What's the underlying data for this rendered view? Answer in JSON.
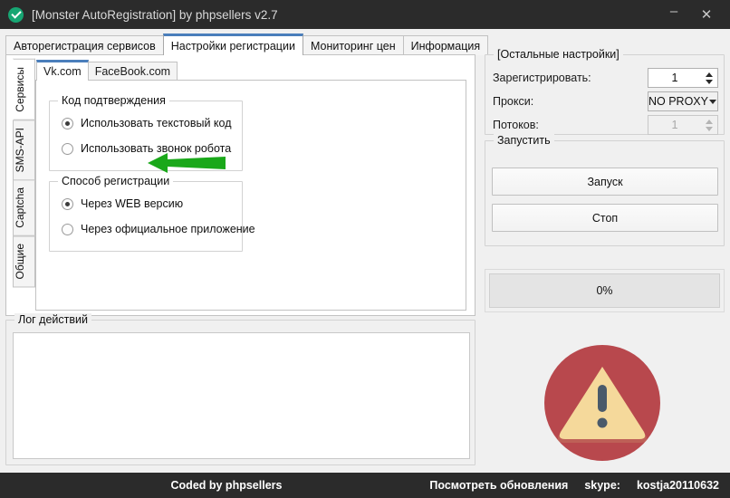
{
  "window": {
    "title": "[Monster AutoRegistration] by phpsellers v2.7",
    "icon": "green-check-circle-icon",
    "minimize_label": "–",
    "close_label": "✕",
    "accent_color": "#4a7ebb",
    "titlebar_color": "#2b2b2b"
  },
  "tabs": [
    {
      "label": "Авторегистрация сервисов",
      "selected": false
    },
    {
      "label": "Настройки регистрации",
      "selected": true
    },
    {
      "label": "Мониторинг цен",
      "selected": false
    },
    {
      "label": "Информация",
      "selected": false
    }
  ],
  "vertical_tabs": [
    {
      "label": "Сервисы",
      "selected": true
    },
    {
      "label": "SMS-API",
      "selected": false
    },
    {
      "label": "Captcha",
      "selected": false
    },
    {
      "label": "Общие",
      "selected": false
    }
  ],
  "service_tabs": [
    {
      "label": "Vk.com",
      "selected": true
    },
    {
      "label": "FaceBook.com",
      "selected": false
    }
  ],
  "confirm_group": {
    "title": "Код подтверждения",
    "options": [
      {
        "label": "Использовать текстовый код",
        "checked": true
      },
      {
        "label": "Использовать звонок робота",
        "checked": false
      }
    ]
  },
  "method_group": {
    "title": "Способ регистрации",
    "options": [
      {
        "label": "Через WEB версию",
        "checked": true
      },
      {
        "label": "Через официальное приложение",
        "checked": false
      }
    ]
  },
  "annotation": {
    "type": "left-arrow",
    "color": "#1aa81a",
    "points_at": "Способ регистрации"
  },
  "log_group": {
    "title": "Лог действий",
    "content": ""
  },
  "settings_group": {
    "title": "[Остальные настройки]",
    "register": {
      "label": "Зарегистрировать:",
      "value": "1"
    },
    "proxy": {
      "label": "Прокси:",
      "value": "NO PROXY"
    },
    "threads": {
      "label": "Потоков:",
      "value": "1",
      "disabled": true
    }
  },
  "run_group": {
    "title": "Запустить",
    "start_label": "Запуск",
    "stop_label": "Стоп"
  },
  "progress": {
    "label": "0%",
    "percent": 0
  },
  "warning_icon": {
    "name": "warning-triangle-icon",
    "circle_color": "#b8484d",
    "triangle_color": "#f5d99b",
    "mark_color": "#4a5a6a"
  },
  "statusbar": {
    "credit": "Coded by phpsellers",
    "updates_link": "Посмотреть обновления",
    "skype_label": "skype:",
    "skype_value": "kostja20110632"
  }
}
